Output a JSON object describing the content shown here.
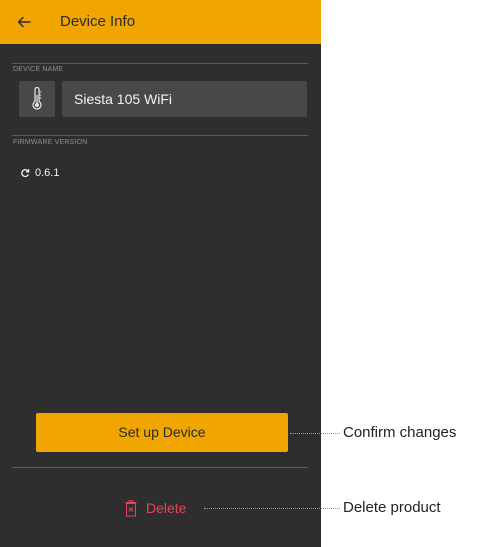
{
  "app_bar": {
    "back_icon": "arrow-left-icon",
    "title": "Device Info",
    "background": "#f0a500"
  },
  "device_name": {
    "label": "DEVICE NAME",
    "icon": "thermometer-icon",
    "value": "Siesta 105 WiFi"
  },
  "firmware": {
    "label": "FIRMWARE VERSION",
    "icon": "refresh-icon",
    "version": "0.6.1"
  },
  "actions": {
    "setup_label": "Set up Device",
    "delete_label": "Delete",
    "delete_icon": "trash-icon",
    "accent": "#f0a500",
    "danger": "#e2445c"
  },
  "annotations": {
    "confirm": "Confirm changes",
    "delete": "Delete product"
  }
}
